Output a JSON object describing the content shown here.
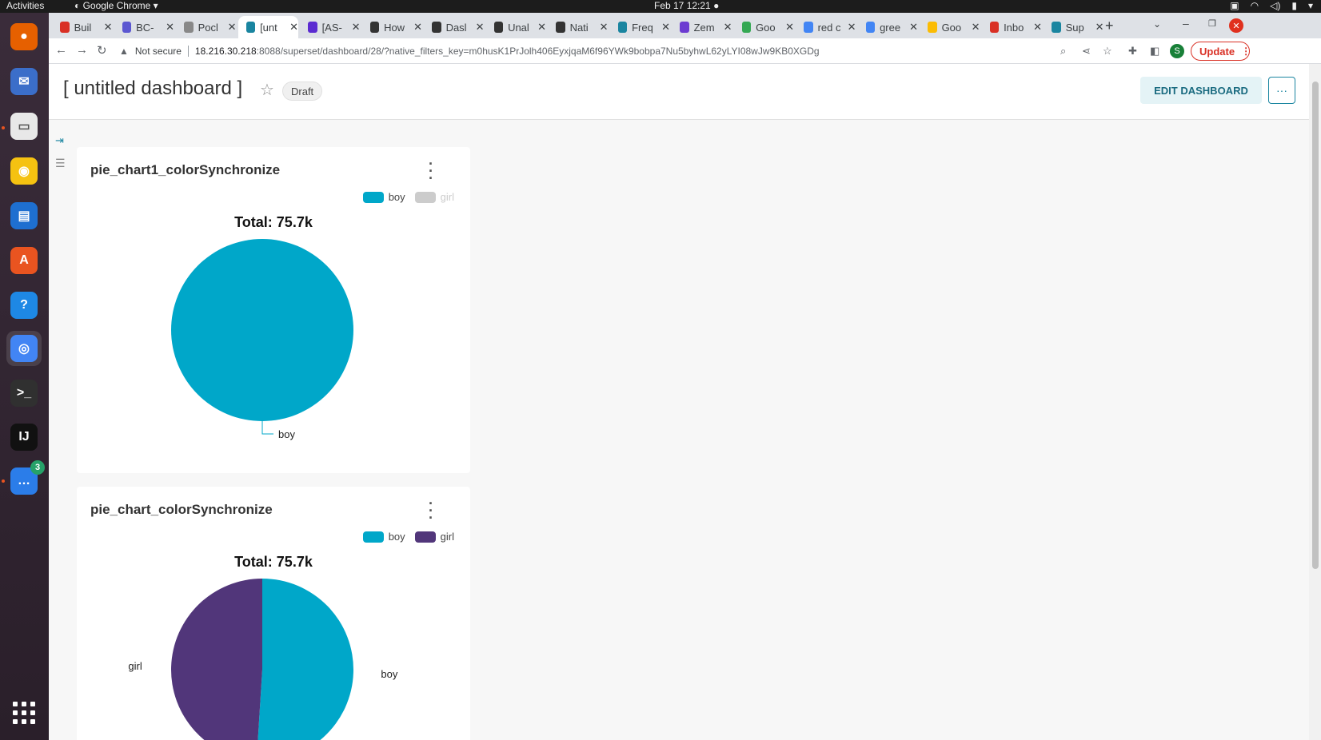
{
  "topbar": {
    "activities": "Activities",
    "app_name": "Google Chrome",
    "clock": "Feb 17  12:21"
  },
  "dock": {
    "apps": [
      {
        "name": "firefox-icon",
        "color": "#e66000",
        "glyph": "●"
      },
      {
        "name": "thunderbird-icon",
        "color": "#3b6ec9",
        "glyph": "✉"
      },
      {
        "name": "files-icon",
        "color": "#e8e8e8",
        "glyph": "▭"
      },
      {
        "name": "rhythmbox-icon",
        "color": "#f5c211",
        "glyph": "◉"
      },
      {
        "name": "writer-icon",
        "color": "#1e6fd0",
        "glyph": "▤"
      },
      {
        "name": "app-center-icon",
        "color": "#e95420",
        "glyph": "A"
      },
      {
        "name": "help-icon",
        "color": "#1e88e5",
        "glyph": "?"
      },
      {
        "name": "chrome-icon",
        "color": "#4285f4",
        "glyph": "◎"
      },
      {
        "name": "terminal-icon",
        "color": "#303030",
        "glyph": ">_"
      },
      {
        "name": "intellij-icon",
        "color": "#111",
        "glyph": "IJ"
      },
      {
        "name": "chat-icon",
        "color": "#2b7de9",
        "glyph": "…",
        "badge": "3"
      }
    ]
  },
  "tabs": [
    {
      "label": "Buil",
      "color": "#d93025"
    },
    {
      "label": "BC-",
      "color": "#5b57d1"
    },
    {
      "label": "Pocl",
      "color": "#888888"
    },
    {
      "label": "[unt",
      "color": "#1a85a0",
      "active": true
    },
    {
      "label": "[AS-",
      "color": "#5b2bd1"
    },
    {
      "label": "How",
      "color": "#333333"
    },
    {
      "label": "Dasl",
      "color": "#333333"
    },
    {
      "label": "Unal",
      "color": "#333333"
    },
    {
      "label": "Nati",
      "color": "#333333"
    },
    {
      "label": "Freq",
      "color": "#1a85a0"
    },
    {
      "label": "Zem",
      "color": "#6c3bd1"
    },
    {
      "label": "Goo",
      "color": "#34a853"
    },
    {
      "label": "red c",
      "color": "#4285f4"
    },
    {
      "label": "gree",
      "color": "#4285f4"
    },
    {
      "label": "Goo",
      "color": "#fbbc04"
    },
    {
      "label": "Inbo",
      "color": "#d93025"
    },
    {
      "label": "Sup",
      "color": "#1a85a0"
    }
  ],
  "toolbar": {
    "not_secure": "Not secure",
    "url_host": "18.216.30.218",
    "url_path": ":8088/superset/dashboard/28/?native_filters_key=m0husK1PrJolh406EyxjqaM6f96YWk9bobpa7Nu5byhwL62yLYI08wJw9KB0XGDg",
    "profile_initial": "S",
    "update_label": "Update"
  },
  "dashboard": {
    "title": "[ untitled dashboard ]",
    "status": "Draft",
    "edit_label": "EDIT DASHBOARD",
    "more_label": "···"
  },
  "colors": {
    "boy": "#00a7c9",
    "girl": "#51367a",
    "disabled": "#cccccc"
  },
  "chart_data": [
    {
      "type": "pie",
      "title": "pie_chart1_colorSynchronize",
      "total_label": "Total: 75.7k",
      "legend": [
        {
          "name": "boy",
          "enabled": true
        },
        {
          "name": "girl",
          "enabled": false
        }
      ],
      "slices": [
        {
          "label": "boy",
          "value": 1.0
        }
      ]
    },
    {
      "type": "pie",
      "title": "pie_chart_colorSynchronize",
      "total_label": "Total: 75.7k",
      "legend": [
        {
          "name": "boy",
          "enabled": true
        },
        {
          "name": "girl",
          "enabled": true
        }
      ],
      "slices": [
        {
          "label": "boy",
          "value": 0.51
        },
        {
          "label": "girl",
          "value": 0.49
        }
      ]
    }
  ]
}
